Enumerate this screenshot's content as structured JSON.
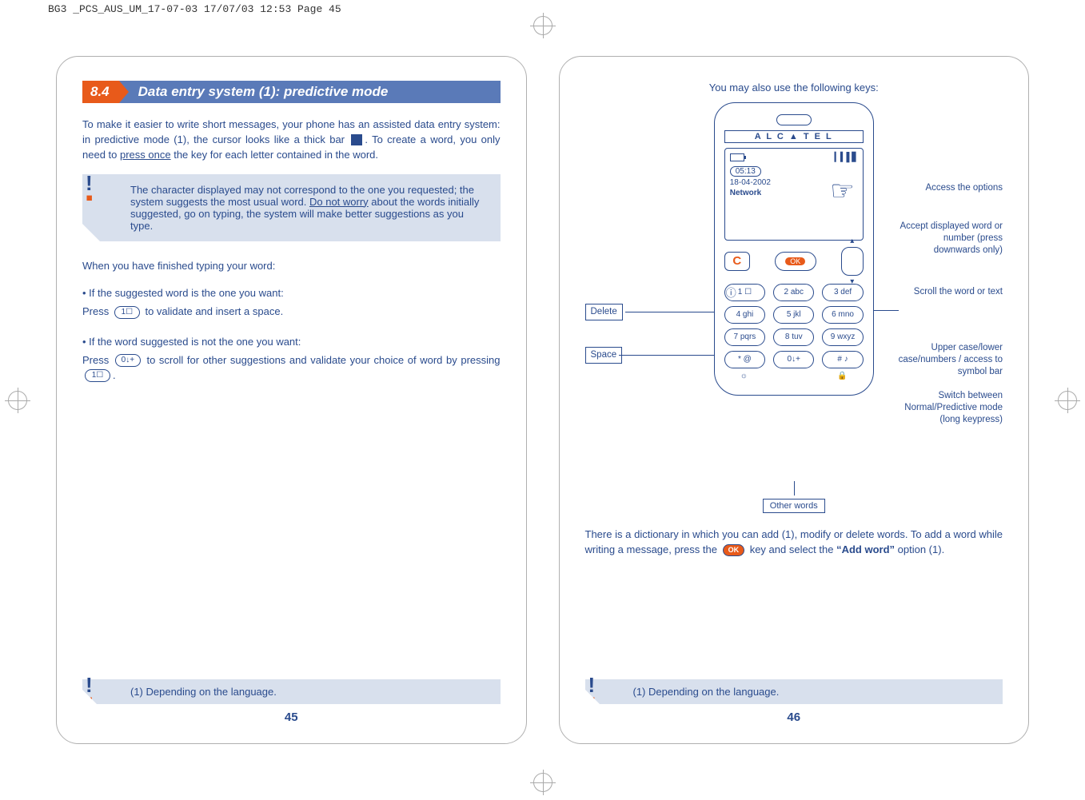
{
  "header": "BG3 _PCS_AUS_UM_17-07-03  17/07/03  12:53  Page 45",
  "left": {
    "section_num": "8.4",
    "section_title": "Data entry system (1): predictive mode",
    "intro_a": "To make it easier to write short messages, your phone has an assisted data entry system: in predictive mode (1), the cursor looks like a thick bar ",
    "intro_b": ". To create a word, you only need to ",
    "intro_press_once": "press once",
    "intro_c": " the key for each letter contained in the word.",
    "info_a": "The character displayed may not correspond to the one you requested; the system suggests the most usual word. ",
    "info_dnw": "Do not worry",
    "info_b": " about the words initially suggested, go on typing, the system will make better suggestions as you type.",
    "when_finished": "When you have finished typing your word:",
    "b1": "• If the suggested word is the one you want:",
    "b1_press": "Press ",
    "b1_key": "1☐",
    "b1_after": " to validate and insert a space.",
    "b2": "• If the word suggested is not the one you want:",
    "b2_press": "Press ",
    "b2_key": "0↓+",
    "b2_after": " to scroll for other suggestions and validate your choice of word by pressing ",
    "b2_key2": "1☐",
    "footnote": "(1)  Depending on the language.",
    "page_num": "45"
  },
  "right": {
    "title": "You may also use the following keys:",
    "brand": "A L C ▲ T E L",
    "screen": {
      "time": "05:13",
      "date": "18-04-2002",
      "network": "Network"
    },
    "keypad": [
      "1 ☐",
      "2 abc",
      "3 def",
      "4 ghi",
      "5 jkl",
      "6 mno",
      "7 pqrs",
      "8 tuv",
      "9 wxyz",
      "* @",
      "0↓+",
      "# ♪"
    ],
    "callouts": {
      "delete": "Delete",
      "space": "Space",
      "access_options": "Access the options",
      "accept": "Accept displayed word or number (press downwards only)",
      "scroll": "Scroll the word or text",
      "upper": "Upper case/lower case/numbers / access to symbol bar",
      "switch": "Switch between Normal/Predictive mode (long keypress)",
      "other_words": "Other words"
    },
    "dict_a": "There is a dictionary in which you can add (1), modify or delete words.  To add a word while writing a message, press the ",
    "dict_ok": "OK",
    "dict_b": " key and select the ",
    "dict_add": "“Add word”",
    "dict_c": " option (1).",
    "footnote": "(1)  Depending on the language.",
    "page_num": "46"
  }
}
